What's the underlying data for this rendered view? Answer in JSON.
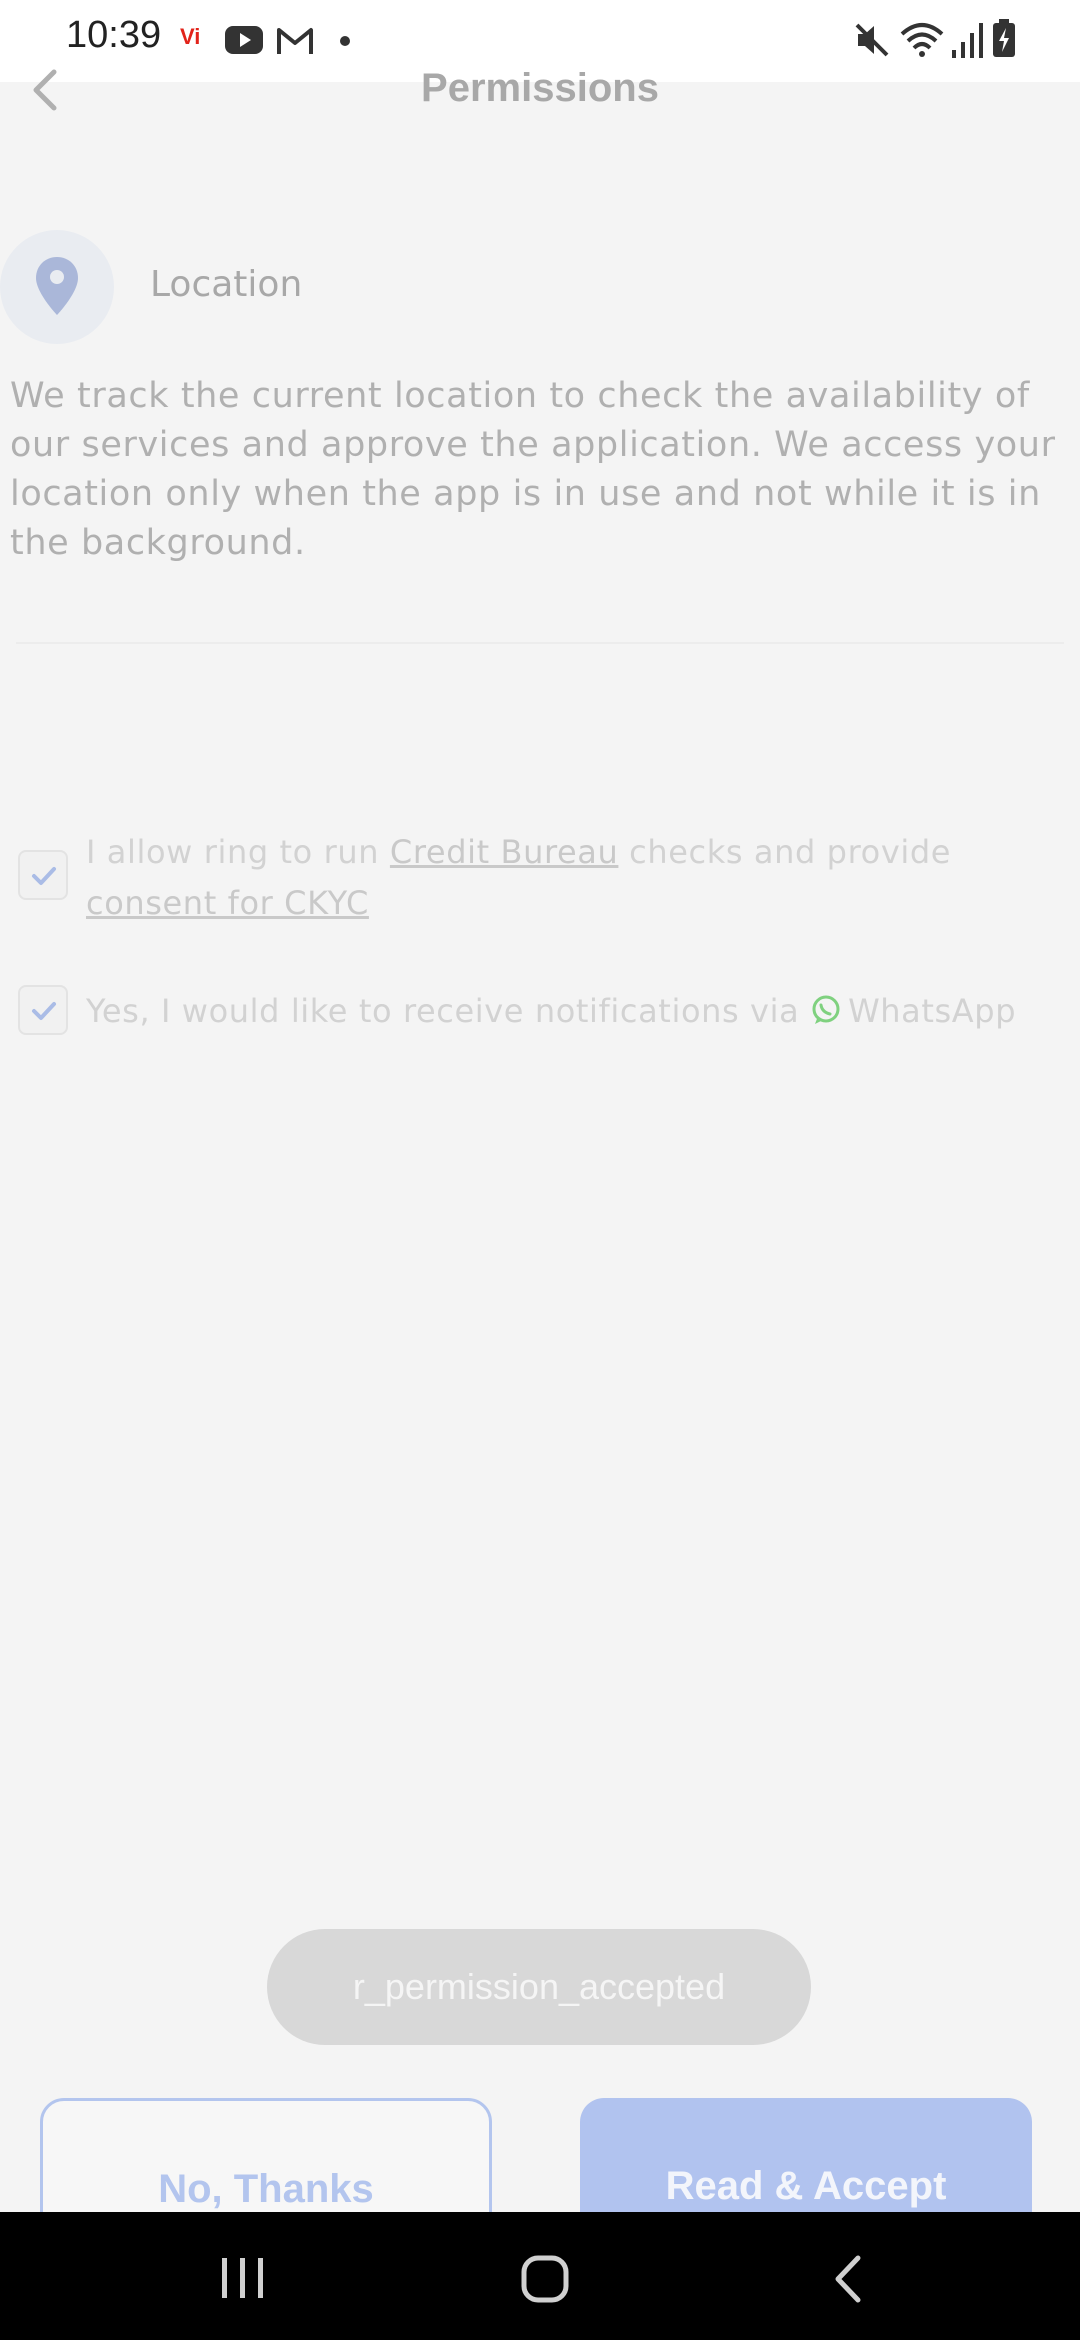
{
  "status_bar": {
    "time": "10:39",
    "carrier_badge": "Vi",
    "icons": [
      "youtube-icon",
      "gmail-icon",
      "notification-dot-icon",
      "mute-icon",
      "wifi-icon",
      "signal-icon",
      "battery-icon"
    ]
  },
  "header": {
    "title": "Permissions",
    "back_icon": "back-arrow-icon"
  },
  "location": {
    "icon": "location-pin-icon",
    "label": "Location",
    "description": "We track the current location to check the availability of our services and approve the application. We access your location only when the app is in use and not while it is in the background."
  },
  "consents": {
    "credit": {
      "checked": true,
      "prefix": "I allow ring to run ",
      "link1": "Credit Bureau",
      "middle": " checks and provide ",
      "link2": "consent for CKYC"
    },
    "whatsapp": {
      "checked": true,
      "text": "Yes, I would like to receive notifications via ",
      "app_name": "WhatsApp",
      "icon": "whatsapp-icon"
    }
  },
  "toast": {
    "message": "r_permission_accepted"
  },
  "buttons": {
    "decline": "No, Thanks",
    "accept": "Read & Accept"
  },
  "colors": {
    "accent": "#b1c3ef",
    "background": "#f4f4f4",
    "whatsapp": "#7fd17f"
  },
  "nav_bar": {
    "icons": [
      "recent-apps-icon",
      "home-icon",
      "back-icon"
    ]
  }
}
